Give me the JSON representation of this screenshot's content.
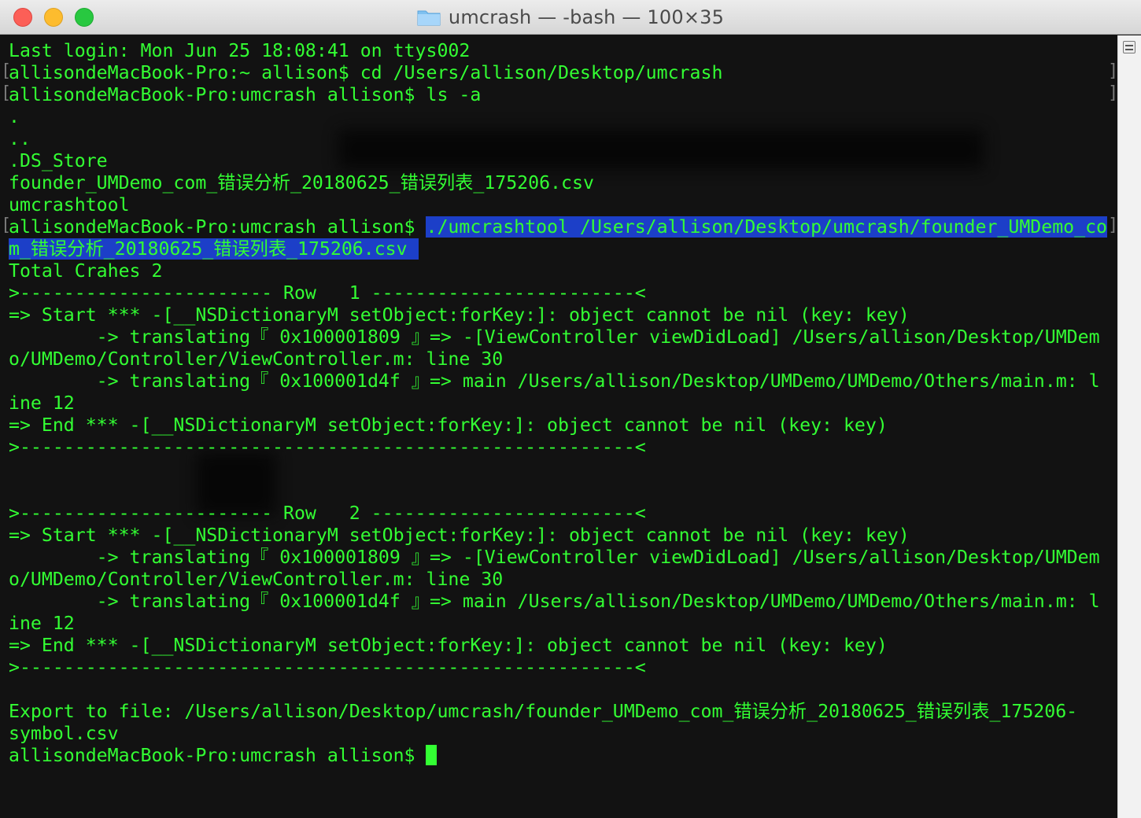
{
  "window": {
    "title": "umcrash — -bash — 100×35",
    "folder_icon": "folder-icon",
    "colors": {
      "text": "#33ff33",
      "background": "#121212",
      "selection": "#1c3fc8"
    }
  },
  "terminal": {
    "lines": [
      "Last login: Mon Jun 25 18:08:41 on ttys002",
      "allisondeMacBook-Pro:~ allison$ cd /Users/allison/Desktop/umcrash",
      "allisondeMacBook-Pro:umcrash allison$ ls -a",
      ".",
      "..",
      ".DS_Store",
      "founder_UMDemo_com_错误分析_20180625_错误列表_175206.csv",
      "umcrashtool",
      "allisondeMacBook-Pro:umcrash allison$ ",
      "",
      "Total Crahes 2",
      ">----------------------- Row   1 ------------------------<",
      "=> Start *** -[__NSDictionaryM setObject:forKey:]: object cannot be nil (key: key)",
      "        -> translating『 0x100001809 』=> -[ViewController viewDidLoad] /Users/allison/Desktop/UMDem",
      "o/UMDemo/Controller/ViewController.m: line 30",
      "        -> translating『 0x100001d4f 』=> main /Users/allison/Desktop/UMDemo/UMDemo/Others/main.m: l",
      "ine 12",
      "=> End *** -[__NSDictionaryM setObject:forKey:]: object cannot be nil (key: key)",
      ">--------------------------------------------------------<",
      "",
      "",
      ">----------------------- Row   2 ------------------------<",
      "=> Start *** -[__NSDictionaryM setObject:forKey:]: object cannot be nil (key: key)",
      "        -> translating『 0x100001809 』=> -[ViewController viewDidLoad] /Users/allison/Desktop/UMDem",
      "o/UMDemo/Controller/ViewController.m: line 30",
      "        -> translating『 0x100001d4f 』=> main /Users/allison/Desktop/UMDemo/UMDemo/Others/main.m: l",
      "ine 12",
      "=> End *** -[__NSDictionaryM setObject:forKey:]: object cannot be nil (key: key)",
      ">--------------------------------------------------------<",
      "",
      "Export to file: /Users/allison/Desktop/umcrash/founder_UMDemo_com_错误分析_20180625_错误列表_175206-",
      "symbol.csv",
      "allisondeMacBook-Pro:umcrash allison$ "
    ],
    "selected_command_part1": "./umcrashtool /Users/allison/Desktop/umcrash/founder_UMDemo_co",
    "selected_command_part2": "m_错误分析_20180625_错误列表_175206.csv "
  },
  "scrollbar": {
    "icon": "scroll-menu-icon"
  }
}
